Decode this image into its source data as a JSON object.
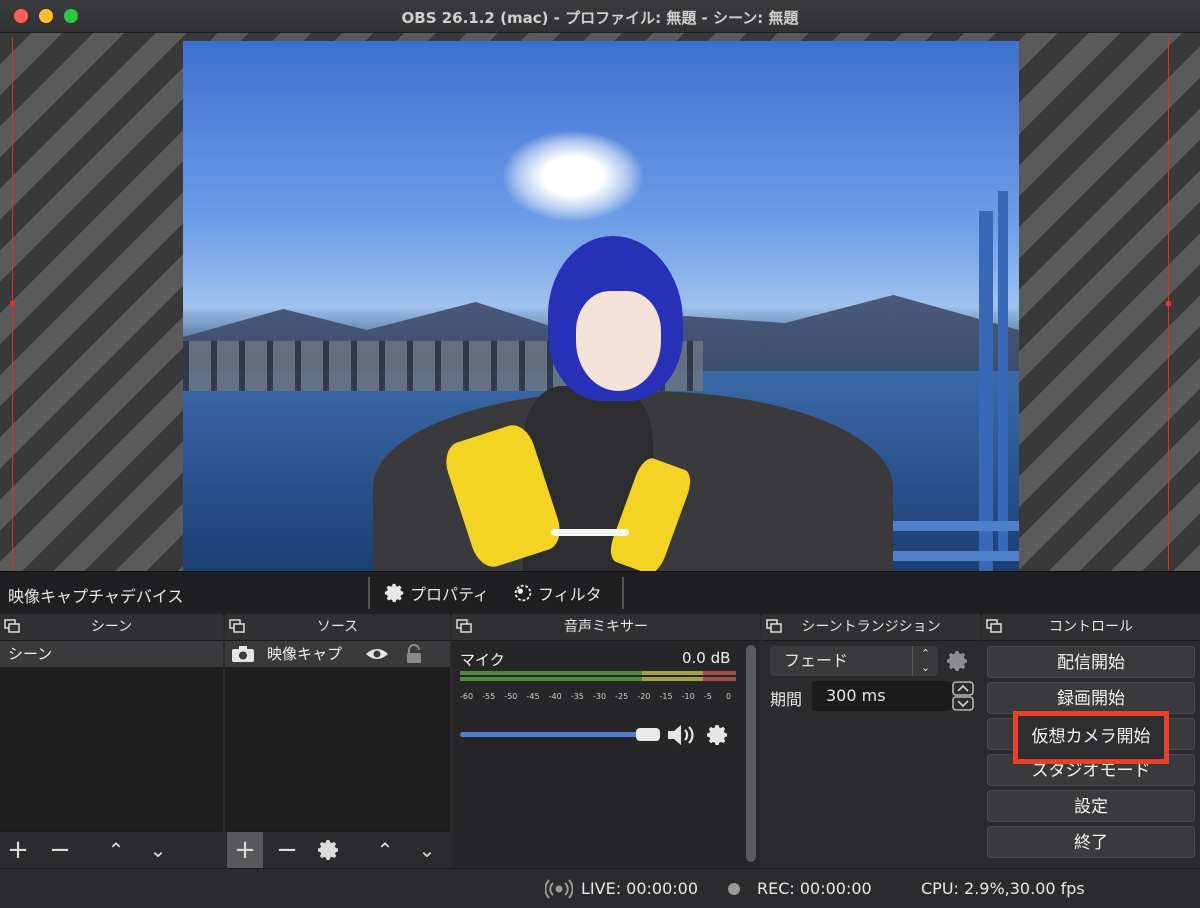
{
  "window": {
    "title": "OBS 26.1.2 (mac) - プロファイル: 無題 - シーン: 無題"
  },
  "source_toolbar": {
    "source_name": "映像キャプチャデバイス",
    "properties_label": "プロパティ",
    "filters_label": "フィルタ"
  },
  "scenes_dock": {
    "title": "シーン",
    "items": [
      "シーン"
    ]
  },
  "sources_dock": {
    "title": "ソース",
    "items": [
      "映像キャプ"
    ]
  },
  "mixer_dock": {
    "title": "音声ミキサー",
    "channel": {
      "name": "マイク",
      "level": "0.0 dB",
      "volume_fraction": 0.82
    },
    "ticks": [
      "-60",
      "-55",
      "-50",
      "-45",
      "-40",
      "-35",
      "-30",
      "-25",
      "-20",
      "-15",
      "-10",
      "-5",
      "0"
    ]
  },
  "transition_dock": {
    "title": "シーントランジション",
    "selected": "フェード",
    "duration_label": "期間",
    "duration_value": "300 ms"
  },
  "controls_dock": {
    "title": "コントロール",
    "buttons": [
      "配信開始",
      "録画開始",
      "仮想カメラ開始",
      "スタジオモード",
      "設定",
      "終了"
    ]
  },
  "status": {
    "live": "LIVE: 00:00:00",
    "rec": "REC: 00:00:00",
    "cpu": "CPU: 2.9%,30.00 fps"
  },
  "colors": {
    "accent": "#4a7fd4",
    "highlight": "#e8402a"
  }
}
